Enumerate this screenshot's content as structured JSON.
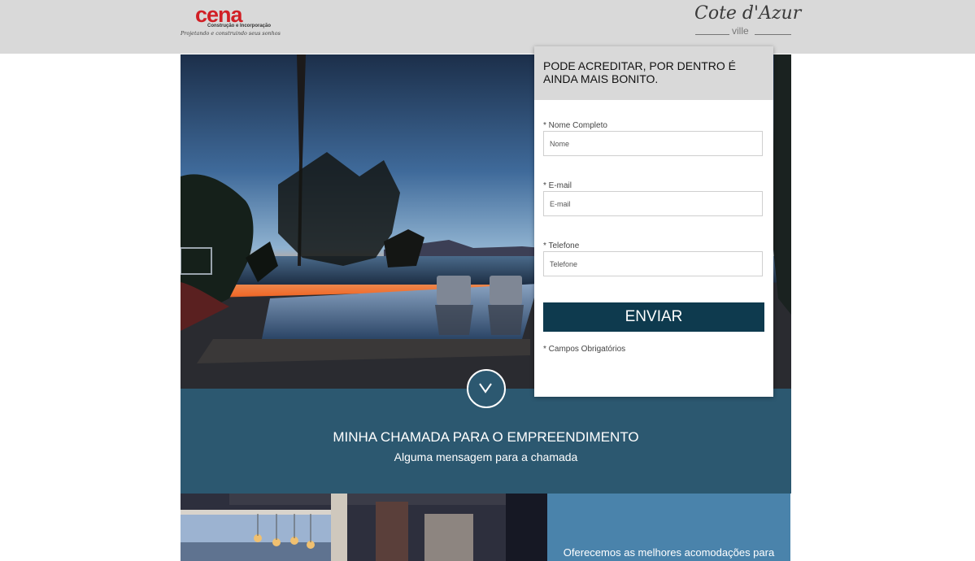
{
  "header": {
    "logo_left": {
      "word": "cena",
      "line1": "Construção e Incorporação",
      "line2": "Projetando e construindo seus sonhos"
    },
    "logo_right": {
      "script": "Cote d'Azur",
      "sub": "ville"
    }
  },
  "form": {
    "heading": "PODE ACREDITAR, POR DENTRO É AINDA MAIS BONITO.",
    "fields": [
      {
        "label": "* Nome Completo",
        "placeholder": "Nome"
      },
      {
        "label": "* E-mail",
        "placeholder": "E-mail"
      },
      {
        "label": "* Telefone",
        "placeholder": "Telefone"
      }
    ],
    "submit_label": "ENVIAR",
    "required_note": "* Campos Obrigatórios"
  },
  "banner": {
    "title": "MINHA CHAMADA PARA O EMPREENDIMENTO",
    "subtitle": "Alguma mensagem para a chamada"
  },
  "info": {
    "text": "Oferecemos as melhores acomodações para"
  },
  "colors": {
    "topbar": "#d9d9d9",
    "banner": "#2c5870",
    "button": "#0e3a4e",
    "info_panel": "#4a83ab",
    "brand_red": "#d11f25"
  }
}
